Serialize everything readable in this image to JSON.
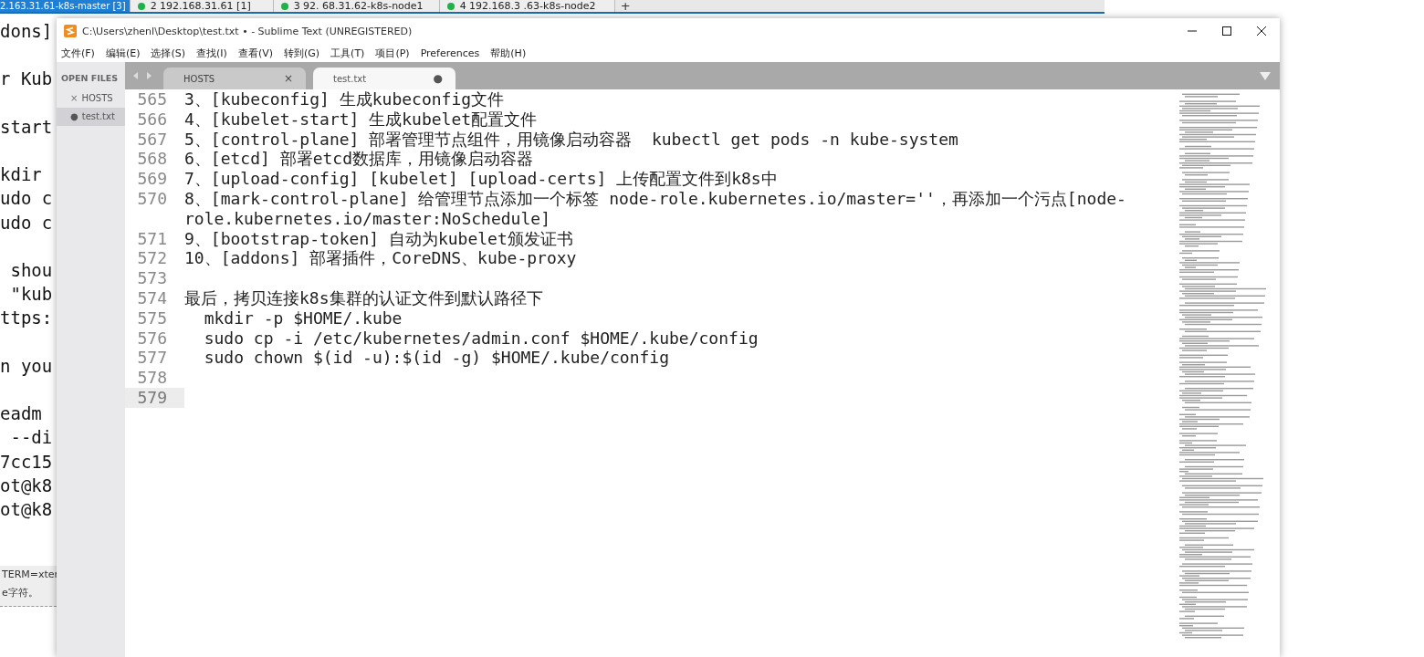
{
  "terminal": {
    "tabs": [
      {
        "label": "2.163.31.61-k8s-master [3]",
        "selected": true,
        "connected": false
      },
      {
        "label": "2 192.168.31.61 [1]",
        "selected": false,
        "connected": true
      },
      {
        "label": "3  92. 68.31.62-k8s-node1",
        "selected": false,
        "connected": true
      },
      {
        "label": "4 192.168.3 .63-k8s-node2",
        "selected": false,
        "connected": true
      }
    ],
    "new_tab": "+",
    "output": "dons]\n\nr Kub\n\nstart\n\nkdir\nudo c\nudo c\n\n shou\n \"kub\nttps:\n\nn you\n\neadm\n --di\n7cc15\not@k8\not@k8",
    "status_lines": [
      "TERM=xter",
      "e字符。"
    ]
  },
  "window": {
    "title": "C:\\Users\\zhenl\\Desktop\\test.txt • - Sublime Text (UNREGISTERED)"
  },
  "menu": [
    "文件(F)",
    "编辑(E)",
    "选择(S)",
    "查找(I)",
    "查看(V)",
    "转到(G)",
    "工具(T)",
    "项目(P)",
    "Preferences",
    "帮助(H)"
  ],
  "sidebar": {
    "heading": "OPEN FILES",
    "items": [
      {
        "label": "HOSTS",
        "selected": false,
        "dirty": false,
        "marker": "×"
      },
      {
        "label": "test.txt",
        "selected": true,
        "dirty": true,
        "marker": "●"
      }
    ]
  },
  "tabs": [
    {
      "label": "HOSTS",
      "selected": false,
      "dirty": false,
      "marker": "×"
    },
    {
      "label": "test.txt",
      "selected": true,
      "dirty": true,
      "marker": "●"
    }
  ],
  "editor": {
    "lines": [
      {
        "number": "565",
        "text": "3、[kubeconfig] 生成kubeconfig文件",
        "current": false
      },
      {
        "number": "566",
        "text": "4、[kubelet-start] 生成kubelet配置文件",
        "current": false
      },
      {
        "number": "567",
        "text": "5、[control-plane] 部署管理节点组件，用镜像启动容器  kubectl get pods -n kube-system",
        "current": false
      },
      {
        "number": "568",
        "text": "6、[etcd] 部署etcd数据库，用镜像启动容器",
        "current": false
      },
      {
        "number": "569",
        "text": "7、[upload-config] [kubelet] [upload-certs] 上传配置文件到k8s中",
        "current": false
      },
      {
        "number": "570",
        "text": "8、[mark-control-plane] 给管理节点添加一个标签 node-role.kubernetes.io/master=''，再添加一个污点[node-role.kubernetes.io/master:NoSchedule]",
        "current": false
      },
      {
        "number": "571",
        "text": "9、[bootstrap-token] 自动为kubelet颁发证书",
        "current": false
      },
      {
        "number": "572",
        "text": "10、[addons] 部署插件，CoreDNS、kube-proxy",
        "current": false
      },
      {
        "number": "573",
        "current": false
      },
      {
        "number": "574",
        "text": "最后，拷贝连接k8s集群的认证文件到默认路径下",
        "current": false
      },
      {
        "number": "575",
        "text": "  mkdir -p $HOME/.kube",
        "current": false
      },
      {
        "number": "576",
        "text": "  sudo cp -i /etc/kubernetes/admin.conf $HOME/.kube/config",
        "current": false
      },
      {
        "number": "577",
        "text": "  sudo chown $(id -u):$(id -g) $HOME/.kube/config",
        "current": false
      },
      {
        "number": "578",
        "current": false
      },
      {
        "number": "579",
        "current": true
      }
    ]
  }
}
